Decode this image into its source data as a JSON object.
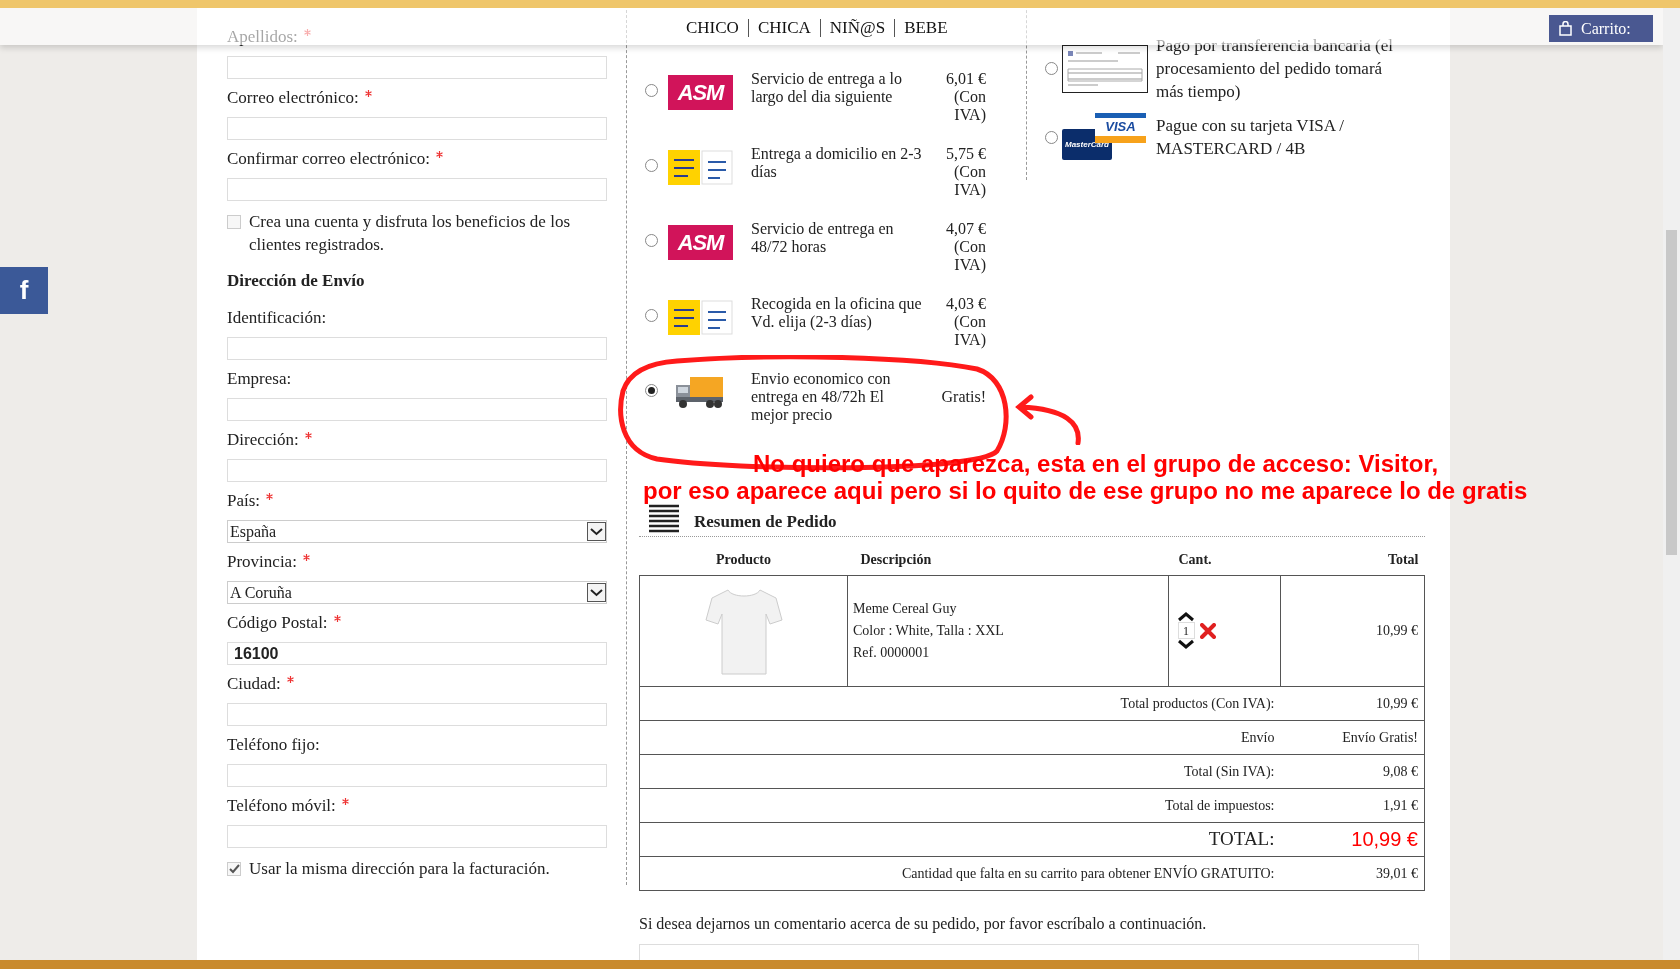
{
  "nav": {
    "links": [
      {
        "label": "CHICO"
      },
      {
        "label": "CHICA"
      },
      {
        "label": "NIÑ@S"
      },
      {
        "label": "BEBE"
      }
    ],
    "cart": "Carrito:"
  },
  "social": {
    "label": "f"
  },
  "form": [
    {
      "kind": "field",
      "label": "Apellidos:",
      "required": true
    },
    {
      "kind": "field",
      "label": "Correo electrónico:",
      "required": true
    },
    {
      "kind": "field",
      "label": "Confirmar correo electrónico:",
      "required": true
    },
    {
      "kind": "checkbox",
      "label": "Crea una cuenta y disfruta los beneficios de los clientes registrados.",
      "checked": false
    },
    {
      "kind": "heading",
      "label": "Dirección de Envío"
    },
    {
      "kind": "field",
      "label": "Identificación:",
      "required": false
    },
    {
      "kind": "field",
      "label": "Empresa:",
      "required": false
    },
    {
      "kind": "field",
      "label": "Dirección:",
      "required": true
    },
    {
      "kind": "select",
      "label": "País:",
      "required": true,
      "value": "España"
    },
    {
      "kind": "select",
      "label": "Provincia:",
      "required": true,
      "value": "A Coruña"
    },
    {
      "kind": "field",
      "label": "Código Postal:",
      "required": true,
      "value": "16100"
    },
    {
      "kind": "field",
      "label": "Ciudad:",
      "required": true
    },
    {
      "kind": "field",
      "label": "Teléfono fijo:",
      "required": false
    },
    {
      "kind": "field",
      "label": "Teléfono móvil:",
      "required": true
    },
    {
      "kind": "checkbox",
      "label": "Usar la misma dirección para la facturación.",
      "checked": true
    }
  ],
  "shipping": [
    {
      "kind": "asm",
      "logo_text": "ASM",
      "text": "Servicio de entrega a lo largo del dia siguiente",
      "price": "6,01 € (Con IVA)",
      "selected": false
    },
    {
      "kind": "correos_home",
      "text": "Entrega a domicilio en 2-3 días",
      "price": "5,75 € (Con IVA)",
      "selected": false
    },
    {
      "kind": "asm",
      "logo_text": "ASM",
      "text": "Servicio de entrega en 48/72 horas",
      "price": "4,07 € (Con IVA)",
      "selected": false
    },
    {
      "kind": "correos_office",
      "text": "Recogida en la oficina que Vd. elija (2-3 días)",
      "price": "4,03 € (Con IVA)",
      "selected": false
    },
    {
      "kind": "truck",
      "text": "Envio economico con entrega en 48/72h El mejor precio",
      "price": "Gratis!",
      "selected": true
    }
  ],
  "payment": [
    {
      "kind": "bank",
      "text": "Pago por transferencia bancaria (el procesamiento del pedido tomará más tiempo)",
      "selected": false
    },
    {
      "kind": "cards",
      "visa": "VISA",
      "mastercard": "MasterCard",
      "text": "Pague con su tarjeta VISA / MASTERCARD / 4B",
      "selected": false
    }
  ],
  "annotation": {
    "lines": [
      "No quiero que aparezca, esta en el grupo de acceso: Visitor,",
      "por eso aparece aqui pero si lo quito de ese grupo no me aparece lo de gratis"
    ]
  },
  "summary": {
    "title": "Resumen de Pedido",
    "columns": [
      "Producto",
      "Descripción",
      "Cant.",
      "Total"
    ],
    "item": {
      "name": "Meme Cereal Guy",
      "attributes": "Color : White, Talla : XXL",
      "ref": "Ref. 0000001",
      "qty": "1",
      "total": "10,99 €"
    },
    "totals": [
      {
        "kind": "normal",
        "label": "Total productos (Con IVA):",
        "value": "10,99 €"
      },
      {
        "kind": "normal",
        "label": "Envío",
        "value": "Envío Gratis!"
      },
      {
        "kind": "normal",
        "label": "Total (Sin IVA):",
        "value": "9,08 €"
      },
      {
        "kind": "normal",
        "label": "Total de impuestos:",
        "value": "1,91 €"
      },
      {
        "kind": "grand",
        "label": "TOTAL:",
        "value": "10,99 €"
      },
      {
        "kind": "normal",
        "label": "Cantidad que falta en su carrito para obtener ENVÍO GRATUITO:",
        "value": "39,01 €"
      }
    ]
  },
  "comment": {
    "prompt": "Si desea dejarnos un comentario acerca de su pedido, por favor escríbalo a continuación."
  }
}
